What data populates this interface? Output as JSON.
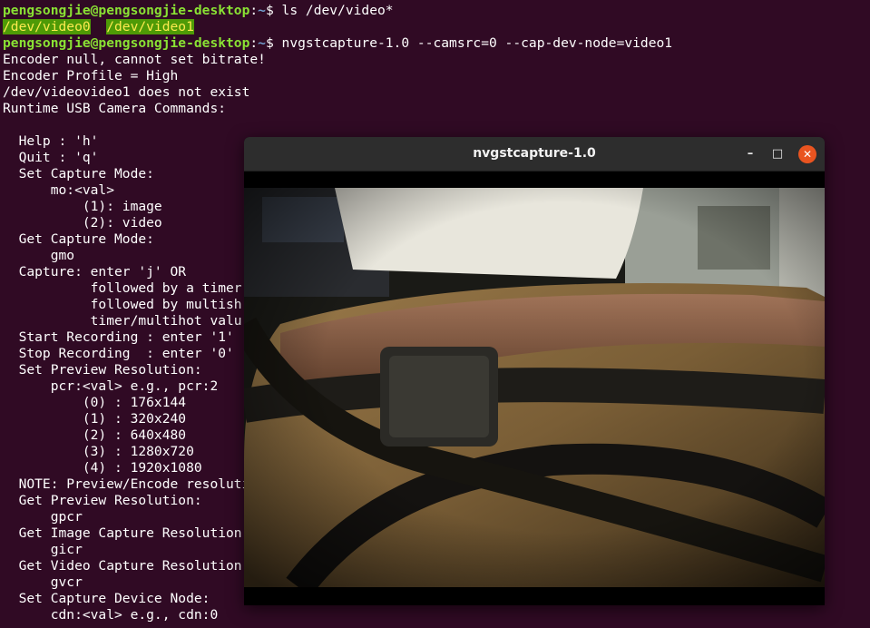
{
  "terminal": {
    "prompt_user": "pengsongjie@pengsongjie-desktop",
    "prompt_sep": ":",
    "prompt_path": "~",
    "prompt_dollar": "$ ",
    "cmd1": "ls /dev/video*",
    "ls_out": [
      "/dev/video0",
      "/dev/video1"
    ],
    "ls_gap": "  ",
    "cmd2": "nvgstcapture-1.0 --camsrc=0 --cap-dev-node=video1",
    "output": [
      "Encoder null, cannot set bitrate!",
      "Encoder Profile = High",
      "/dev/videovideo1 does not exist",
      "Runtime USB Camera Commands:",
      "",
      "  Help : 'h'",
      "  Quit : 'q'",
      "  Set Capture Mode:",
      "      mo:<val>",
      "          (1): image",
      "          (2): video",
      "  Get Capture Mode:",
      "      gmo",
      "  Capture: enter 'j' OR",
      "           followed by a timer",
      "           followed by multish",
      "           timer/multihot valu",
      "  Start Recording : enter '1'",
      "  Stop Recording  : enter '0'",
      "  Set Preview Resolution:",
      "      pcr:<val> e.g., pcr:2",
      "          (0) : 176x144",
      "          (1) : 320x240",
      "          (2) : 640x480",
      "          (3) : 1280x720",
      "          (4) : 1920x1080",
      "  NOTE: Preview/Encode resolutio",
      "  Get Preview Resolution:",
      "      gpcr",
      "  Get Image Capture Resolution",
      "      gicr",
      "  Get Video Capture Resolution",
      "      gvcr",
      "  Set Capture Device Node:",
      "      cdn:<val> e.g., cdn:0"
    ]
  },
  "window": {
    "title": "nvgstcapture-1.0",
    "minimize_glyph": "–",
    "maximize_glyph": "□",
    "close_glyph": "✕"
  },
  "colors": {
    "terminal_bg": "#300a24",
    "prompt_user": "#8ae234",
    "prompt_path": "#729fcf",
    "close_button": "#e95420"
  }
}
